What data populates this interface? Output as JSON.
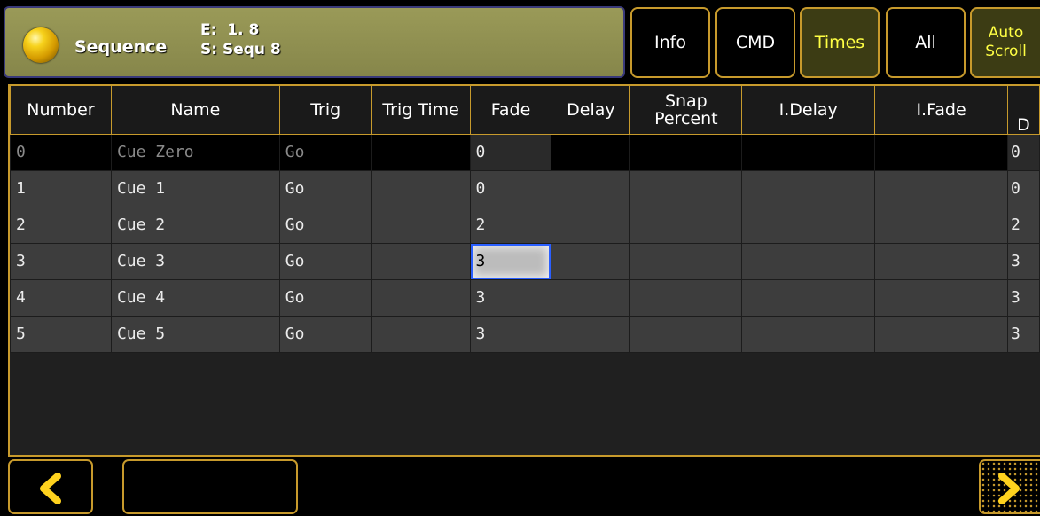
{
  "header": {
    "title": "Sequence",
    "executor_line": "E:  1. 8",
    "sequence_line": "S: Sequ 8",
    "buttons": [
      {
        "label": "Info",
        "active": false
      },
      {
        "label": "CMD",
        "active": false
      },
      {
        "label": "Times",
        "active": true
      },
      {
        "label": "All",
        "active": false
      },
      {
        "label": "Auto\nScroll",
        "active": true
      }
    ]
  },
  "table": {
    "columns": [
      "Number",
      "Name",
      "Trig",
      "Trig Time",
      "Fade",
      "Delay",
      "Snap Percent",
      "I.Delay",
      "I.Fade",
      "D"
    ],
    "rows": [
      [
        "0",
        "Cue Zero",
        "Go",
        "",
        "0",
        "",
        "",
        "",
        "",
        "0"
      ],
      [
        "1",
        "Cue 1",
        "Go",
        "",
        "0",
        "",
        "",
        "",
        "",
        "0"
      ],
      [
        "2",
        "Cue 2",
        "Go",
        "",
        "2",
        "",
        "",
        "",
        "",
        "2"
      ],
      [
        "3",
        "Cue 3",
        "Go",
        "",
        "3",
        "",
        "",
        "",
        "",
        "3"
      ],
      [
        "4",
        "Cue 4",
        "Go",
        "",
        "3",
        "",
        "",
        "",
        "",
        "3"
      ],
      [
        "5",
        "Cue 5",
        "Go",
        "",
        "3",
        "",
        "",
        "",
        "",
        "3"
      ]
    ],
    "selected_cell": {
      "row": 3,
      "column": "Fade"
    }
  },
  "colors": {
    "accent": "#c79a2c",
    "active_text": "#ffff44",
    "title_bar": "#8f8f50",
    "selection_border": "#2a5fff"
  },
  "icons": [
    "sequence-ball-icon",
    "chevron-left-icon",
    "chevron-right-icon"
  ]
}
